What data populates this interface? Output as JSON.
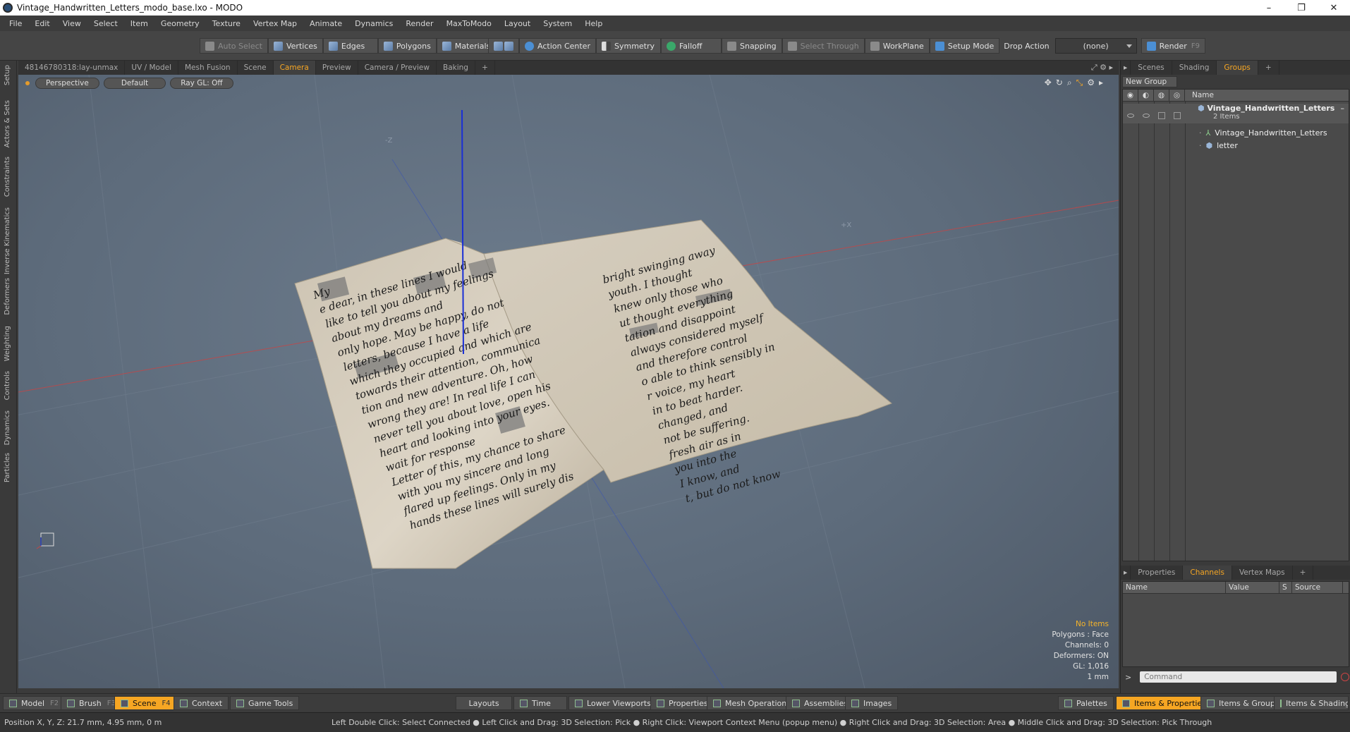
{
  "window": {
    "title": "Vintage_Handwritten_Letters_modo_base.lxo - MODO",
    "controls": [
      "–",
      "❐",
      "✕"
    ]
  },
  "menu": [
    "File",
    "Edit",
    "View",
    "Select",
    "Item",
    "Geometry",
    "Texture",
    "Vertex Map",
    "Animate",
    "Dynamics",
    "Render",
    "MaxToModo",
    "Layout",
    "System",
    "Help"
  ],
  "toolbar": {
    "auto_select": "Auto Select",
    "vertices": "Vertices",
    "edges": "Edges",
    "polygons": "Polygons",
    "materials": "Materials",
    "action_center": "Action Center",
    "symmetry": "Symmetry",
    "falloff": "Falloff",
    "snapping": "Snapping",
    "select_through": "Select Through",
    "workplane": "WorkPlane",
    "setup_mode": "Setup Mode",
    "drop_action_label": "Drop Action",
    "drop_action_value": "(none)",
    "render": "Render",
    "render_key": "F9"
  },
  "left_tabs": [
    "Setup",
    "Actors & Sets",
    "Constraints",
    "Inverse Kinematics",
    "Deformers",
    "Weighting",
    "Controls",
    "Dynamics",
    "Particles"
  ],
  "viewport_tabs": [
    "48146780318:lay-unmax",
    "UV / Model",
    "Mesh Fusion",
    "Scene",
    "Camera",
    "Preview",
    "Camera / Preview",
    "Baking",
    "+"
  ],
  "viewport": {
    "perspective": "Perspective",
    "shading": "Default",
    "raygl": "Ray GL: Off",
    "axis_z": "-Z",
    "axis_x": "+X"
  },
  "letter_text": {
    "left": [
      "My",
      "e dear, in these lines I would",
      "like to tell you about my feelings",
      "about my dreams and",
      "only hope. May be happy, do not",
      "letters, because I have a life",
      "which they occupied and which are",
      "towards their attention, communica",
      "tion and new adventure. Oh, how",
      "wrong they are! In real life I can",
      "never tell you about love, open his",
      "heart and looking into your eyes.",
      "wait for response",
      "Letter of this, my chance to share",
      "with you my sincere and long",
      "flared up feelings. Only in my",
      "hands these lines will surely dis"
    ],
    "right": [
      "bright swinging away",
      "youth. I thought",
      "knew only those who",
      "ut thought everything",
      "tation and disappoint",
      "always considered myself",
      "and therefore control",
      "o able to think sensibly in",
      "r voice, my heart",
      "in to beat harder.",
      "changed, and",
      "not be suffering.",
      "fresh air as in",
      "you into the",
      "I know, and",
      "t, but do not know"
    ]
  },
  "stats": {
    "no_items": "No Items",
    "polygons": "Polygons : Face",
    "channels": "Channels: 0",
    "deformers": "Deformers: ON",
    "gl": "GL: 1,016",
    "unit": "1 mm"
  },
  "right_tabs_top": [
    "Scenes",
    "Shading",
    "Groups",
    "+"
  ],
  "groups": {
    "new_group": "New Group",
    "col_name": "Name",
    "root": "Vintage_Handwritten_Letters",
    "root_count": "2 Items",
    "children": [
      "Vintage_Handwritten_Letters",
      "letter"
    ]
  },
  "right_tabs_bottom": [
    "Properties",
    "Channels",
    "Vertex Maps",
    "+"
  ],
  "channels": {
    "cols": [
      "Name",
      "Value",
      "S",
      "Source"
    ]
  },
  "command": {
    "prompt": ">",
    "placeholder": "Command"
  },
  "bottom": {
    "model": "Model",
    "model_key": "F2",
    "brush": "Brush",
    "brush_key": "F3",
    "scene": "Scene",
    "scene_key": "F4",
    "context": "Context",
    "game_tools": "Game Tools",
    "layouts": "Layouts",
    "time": "Time",
    "lower_viewports": "Lower Viewports",
    "properties": "Properties",
    "mesh_operations": "Mesh Operations",
    "assemblies": "Assemblies",
    "images": "Images",
    "palettes": "Palettes",
    "items_properties": "Items & Properties",
    "items_groups": "Items & Groups",
    "items_shading": "Items & Shading"
  },
  "status": {
    "position": "Position X, Y, Z:  21.7 mm, 4.95 mm, 0 m",
    "hints": "Left Double Click: Select Connected ● Left Click and Drag: 3D Selection: Pick ● Right Click: Viewport Context Menu (popup menu) ● Right Click and Drag: 3D Selection: Area ● Middle Click and Drag: 3D Selection: Pick Through"
  },
  "colors": {
    "accent": "#f6a623",
    "axis_y": "#1a2fd6",
    "axis_x": "#c94444",
    "paper": "#d9d1c3"
  }
}
